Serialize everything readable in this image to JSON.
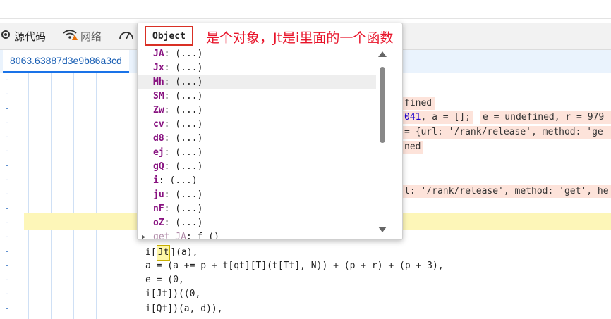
{
  "tabs": [
    {
      "label": "源代码",
      "icon": "gear-icon"
    },
    {
      "label": "网络",
      "icon": "wifi-warning-icon"
    },
    {
      "label": "",
      "icon": "performance-gauge-icon"
    }
  ],
  "file_tab": {
    "label": "8063.63887d3e9b86a3cd"
  },
  "popup": {
    "title": "Object",
    "properties": [
      {
        "key": "JA",
        "value": ": (...)"
      },
      {
        "key": "Jx",
        "value": ": (...)"
      },
      {
        "key": "Mh",
        "value": ": (...)"
      },
      {
        "key": "SM",
        "value": ": (...)"
      },
      {
        "key": "Zw",
        "value": ": (...)"
      },
      {
        "key": "cv",
        "value": ": (...)"
      },
      {
        "key": "d8",
        "value": ": (...)"
      },
      {
        "key": "ej",
        "value": ": (...)"
      },
      {
        "key": "gQ",
        "value": ": (...)"
      },
      {
        "key": "i",
        "value": ": (...)"
      },
      {
        "key": "ju",
        "value": ": (...)"
      },
      {
        "key": "nF",
        "value": ": (...)"
      },
      {
        "key": "oZ",
        "value": ": (...)"
      },
      {
        "key": "get JA",
        "value": ": f ()"
      }
    ]
  },
  "annotation": "是个对象，Jt是i里面的一个函数",
  "inline_values": {
    "v1": "fined",
    "v2": "041, a = [];",
    "v3": "e = undefined, r = 979",
    "v4": "= {url: '/rank/release', method: 'ge",
    "v5": "ned",
    "v6": "l: '/rank/release', method: 'get', he"
  },
  "code_lines": [
    {
      "pre": "",
      "box": "",
      "post": ""
    },
    {
      "pre": "",
      "box": "",
      "post": ""
    },
    {
      "pre": "",
      "box": "",
      "post": ""
    },
    {
      "pre": "",
      "box": "",
      "post": ""
    },
    {
      "pre": "",
      "box": "",
      "post": ""
    },
    {
      "pre": "",
      "box": "",
      "post": ""
    },
    {
      "pre": "",
      "box": "",
      "post": ""
    },
    {
      "pre": "",
      "box": "",
      "post": ""
    },
    {
      "pre": "",
      "box": "",
      "post": ""
    },
    {
      "pre": "",
      "box": "",
      "post": ""
    },
    {
      "pre": "",
      "box": "",
      "post": ""
    },
    {
      "pre": "",
      "box": "",
      "post": ""
    },
    {
      "pre": "i[",
      "box": "Jt",
      "post": "](a),"
    },
    {
      "pre": "a = (a += p + t[qt][T](t[Tt], N)) + (p + r) + (p + 3),",
      "box": "",
      "post": ""
    },
    {
      "pre": "e = (0,",
      "box": "",
      "post": ""
    },
    {
      "pre": "i[Jt])((0,",
      "box": "",
      "post": ""
    },
    {
      "pre": "i[Qt])(a, d)),",
      "box": "",
      "post": ""
    }
  ]
}
